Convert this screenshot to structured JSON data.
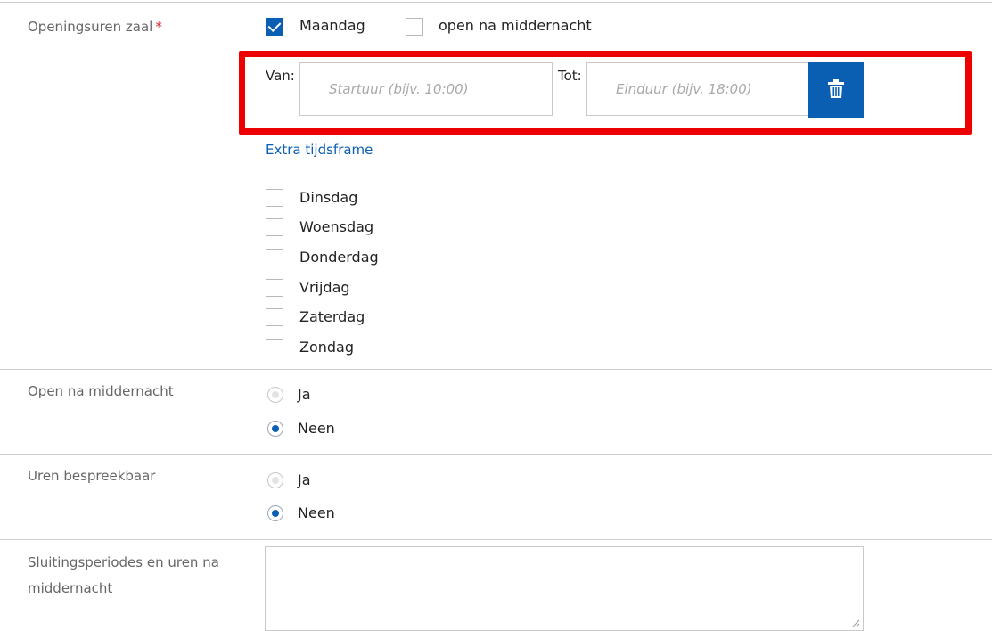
{
  "opening_hours": {
    "label": "Openingsuren zaal",
    "required_mark": "*",
    "monday": {
      "label": "Maandag",
      "checked": true
    },
    "after_midnight": {
      "label": "open na middernacht",
      "checked": false
    },
    "timeframe": {
      "from_label": "Van:",
      "from_placeholder": "Startuur (bijv. 10:00)",
      "to_label": "Tot:",
      "to_placeholder": "Einduur (bijv. 18:00)"
    },
    "extra_link": "Extra tijdsframe",
    "days": [
      {
        "label": "Dinsdag",
        "checked": false
      },
      {
        "label": "Woensdag",
        "checked": false
      },
      {
        "label": "Donderdag",
        "checked": false
      },
      {
        "label": "Vrijdag",
        "checked": false
      },
      {
        "label": "Zaterdag",
        "checked": false
      },
      {
        "label": "Zondag",
        "checked": false
      }
    ]
  },
  "open_after_midnight": {
    "label": "Open na middernacht",
    "options": [
      {
        "label": "Ja",
        "selected": false
      },
      {
        "label": "Neen",
        "selected": true
      }
    ]
  },
  "hours_negotiable": {
    "label": "Uren bespreekbaar",
    "options": [
      {
        "label": "Ja",
        "selected": false
      },
      {
        "label": "Neen",
        "selected": true
      }
    ]
  },
  "closing_periods": {
    "label_line1": "Sluitingsperiodes en uren na",
    "label_line2": "middernacht",
    "value": ""
  },
  "colors": {
    "accent": "#0b5fb3",
    "highlight": "#ee0000",
    "required": "#d9262c"
  },
  "icons": {
    "checkmark": "check-icon",
    "delete": "trash-icon"
  }
}
